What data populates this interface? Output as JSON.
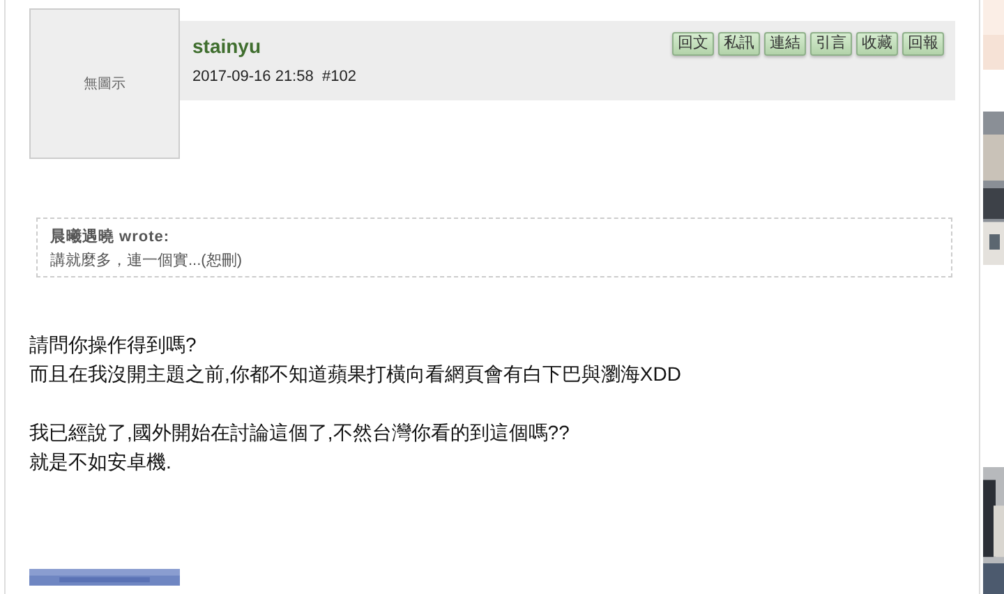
{
  "post": {
    "avatar_text": "無圖示",
    "username": "stainyu",
    "meta": "2017-09-16 21:58  #102",
    "actions": [
      "回文",
      "私訊",
      "連結",
      "引言",
      "收藏",
      "回報"
    ],
    "quote": {
      "author": "晨曦遇曉 wrote:",
      "text": "講就麼多，連一個實...(恕刪)"
    },
    "paragraphs": [
      [
        "請問你操作得到嗎?",
        "而且在我沒開主題之前,你都不知道蘋果打橫向看網頁會有白下巴與瀏海XDD"
      ],
      [
        "我已經說了,國外開始在討論這個了,不然台灣你看的到這個嗎??",
        "就是不如安卓機."
      ]
    ]
  }
}
